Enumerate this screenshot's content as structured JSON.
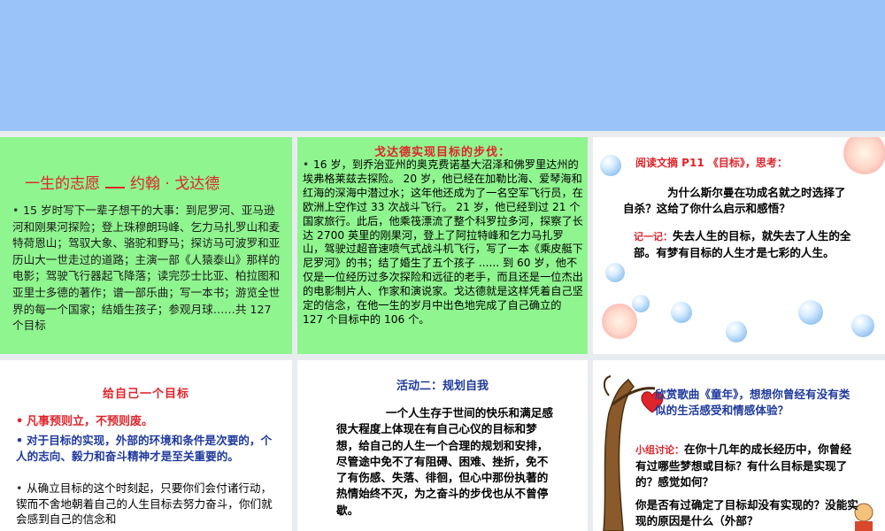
{
  "panel1": {
    "title_left": "一生的志愿",
    "title_right": "约翰 · 戈达德",
    "body": "15 岁时写下一辈子想干的大事：到尼罗河、亚马逊河和刚果河探险；登上珠穆朗玛峰、乞力马扎罗山和麦特荷恩山；驾驭大象、骆驼和野马；探访马可波罗和亚历山大一世走过的道路；主演一部《人猿泰山》那样的电影；驾驶飞行器起飞降落；读完莎士比亚、柏拉图和亚里士多德的著作；谱一部乐曲；写一本书；游览全世界的每一个国家；结婚生孩子；参观月球……共 127 个目标"
  },
  "panel2": {
    "title": "戈达德实现目标的步伐：",
    "body": "16 岁，到乔治亚州的奥克费诺基大沼泽和佛罗里达州的埃弗格莱兹去探险。 20 岁，他已经在加勒比海、爱琴海和红海的深海中潜过水；这年他还成为了一名空军飞行员，在欧洲上空作过 33 次战斗飞行。 21 岁，他已经到过 21 个国家旅行。此后，他乘筏漂流了整个科罗拉多河，探察了长达 2700 英里的刚果河，登上了阿拉特峰和乞力马扎罗山，驾驶过超音速喷气式战斗机飞行，写了一本《乘皮艇下尼罗河》的书；结了婚生了五个孩子 ...... 到 60 岁，他不仅是一位经历过多次探险和远征的老手，而且还是一位杰出的电影制片人、作家和演说家。戈达德就是这样凭着自己坚定的信念，在他一生的岁月中出色地完成了自己确立的 127 个目标中的 106 个。"
  },
  "panel3": {
    "heading": "阅读文摘 P11 《目标》，思考：",
    "question": "为什么斯尔曼在功成名就之时选择了自杀？这给了你什么启示和感悟？",
    "note_label": "记一记：",
    "note_text": "失去人生的目标，就失去了人生的全部。有梦有目标的人生才是七彩的人生。"
  },
  "panel4": {
    "title": "给自己一个目标",
    "line1": "凡事预则立，不预则废。",
    "line2": "对于目标的实现，外部的环境和条件是次要的，个人的志向、毅力和奋斗精神才是至关重要的。",
    "line3": "从确立目标的这个时刻起，只要你们会付诸行动，锲而不舍地朝着自己的人生目标去努力奋斗，你们就会感到自己的信念和"
  },
  "panel5": {
    "title": "活动二：规划自我",
    "body": "一个人生存于世间的快乐和满足感很大程度上体现在有自己心仪的目标和梦想，给自己的人生一个合理的规划和安排，尽管途中免不了有阻碍、困难、挫折，免不了有伤感、失落、徘徊，但心中那份执著的热情始终不灭，为之奋斗的步伐也从不曾停歇。"
  },
  "panel6": {
    "song": "欣赏歌曲《童年》，想想你曾经有没有类似的生活感受和情感体验？",
    "discuss_label": "小组讨论：",
    "discuss_text": "在你十几年的成长经历中，你曾经有过哪些梦想或目标？有什么目标是实现了的？感觉如何？",
    "extra": "你是否有过确定了目标却没有实现的？没能实现的原因是什么（外部？"
  },
  "colors": {
    "banner": "#99c3f9",
    "green_panel": "#8ff58f",
    "red_text": "#e0242b",
    "blue_text": "#1f3a9e"
  }
}
